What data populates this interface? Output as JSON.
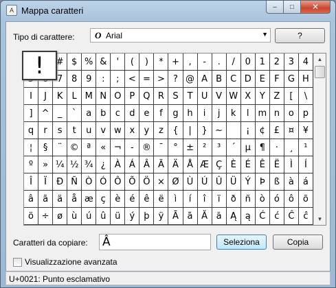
{
  "window": {
    "title": "Mappa caratteri",
    "minimize_glyph": "–",
    "maximize_glyph": "□",
    "close_glyph": "✕"
  },
  "font": {
    "label": "Tipo di carattere:",
    "value": "Arial",
    "icon_glyph": "O",
    "dropdown_glyph": "▼"
  },
  "help_button": "?",
  "grid": {
    "enlarged_char": "!",
    "chars": [
      "!",
      "\"",
      "#",
      "$",
      "%",
      "&",
      "'",
      "(",
      ")",
      "*",
      "+",
      ",",
      "-",
      ".",
      "/",
      "0",
      "1",
      "2",
      "3",
      "4",
      "5",
      "6",
      "7",
      "8",
      "9",
      ":",
      ";",
      "<",
      "=",
      ">",
      "?",
      "@",
      "A",
      "B",
      "C",
      "D",
      "E",
      "F",
      "G",
      "H",
      "I",
      "J",
      "K",
      "L",
      "M",
      "N",
      "O",
      "P",
      "Q",
      "R",
      "S",
      "T",
      "U",
      "V",
      "W",
      "X",
      "Y",
      "Z",
      "[",
      "\\",
      "]",
      "^",
      "_",
      "`",
      "a",
      "b",
      "c",
      "d",
      "e",
      "f",
      "g",
      "h",
      "i",
      "j",
      "k",
      "l",
      "m",
      "n",
      "o",
      "p",
      "q",
      "r",
      "s",
      "t",
      "u",
      "v",
      "w",
      "x",
      "y",
      "z",
      "{",
      "|",
      "}",
      "~",
      " ",
      "¡",
      "¢",
      "£",
      "¤",
      "¥",
      "¦",
      "§",
      "¨",
      "©",
      "ª",
      "«",
      "¬",
      "-",
      "®",
      "¯",
      "°",
      "±",
      "²",
      "³",
      "´",
      "µ",
      "¶",
      "·",
      "¸",
      "¹",
      "º",
      "»",
      "¼",
      "½",
      "¾",
      "¿",
      "À",
      "Á",
      "Â",
      "Ã",
      "Ä",
      "Å",
      "Æ",
      "Ç",
      "È",
      "É",
      "Ê",
      "Ë",
      "Ì",
      "Í",
      "Î",
      "Ï",
      "Ð",
      "Ñ",
      "Ò",
      "Ó",
      "Ô",
      "Õ",
      "Ö",
      "×",
      "Ø",
      "Ù",
      "Ú",
      "Û",
      "Ü",
      "Ý",
      "Þ",
      "ß",
      "à",
      "á",
      "â",
      "ã",
      "ä",
      "å",
      "æ",
      "ç",
      "è",
      "é",
      "ê",
      "ë",
      "ì",
      "í",
      "î",
      "ï",
      "ð",
      "ñ",
      "ò",
      "ó",
      "ô",
      "õ",
      "ö",
      "÷",
      "ø",
      "ù",
      "ú",
      "û",
      "ü",
      "ý",
      "þ",
      "ÿ",
      "Ā",
      "ā",
      "Ă",
      "ă",
      "Ą",
      "ą",
      "Ć",
      "ć",
      "Ĉ",
      "ĉ"
    ]
  },
  "scrollbar": {
    "up_glyph": "▲",
    "down_glyph": "▼"
  },
  "copy": {
    "label": "Caratteri da copiare:",
    "value": "Â",
    "select_button": "Seleziona",
    "copy_button": "Copia"
  },
  "advanced": {
    "label": "Visualizzazione avanzata",
    "checked": false
  },
  "status": "U+0021: Punto esclamativo"
}
